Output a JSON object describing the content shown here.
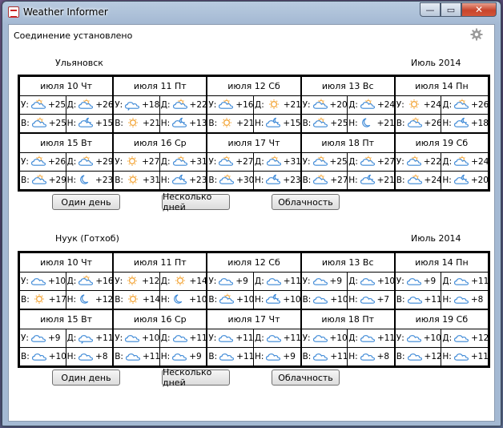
{
  "window": {
    "title": "Weather Informer",
    "minimize": "—",
    "maximize": "▭",
    "close": "✕"
  },
  "status": "Соединение установлено",
  "icon_legend": {
    "sun": "sun-icon",
    "cloud": "cloud-icon",
    "partly": "partly-cloudy-icon",
    "rain": "rain-cloud-icon",
    "moon": "moon-icon",
    "night_cloud": "night-cloud-icon"
  },
  "colors": {
    "sun": "#f3a63a",
    "cloud": "#3a87d6",
    "border": "#000000"
  },
  "buttons": {
    "one_day": "Один день",
    "several_days": "Несколько дней",
    "cloudiness": "Облачность"
  },
  "panels": [
    {
      "city": "Ульяновск",
      "month": "Июль 2014",
      "days": [
        {
          "date": "июля 10 Чт",
          "cells": [
            {
              "label": "У:",
              "icon": "partly",
              "temp": "+25"
            },
            {
              "label": "Д:",
              "icon": "partly",
              "temp": "+26"
            },
            {
              "label": "В:",
              "icon": "partly",
              "temp": "+25"
            },
            {
              "label": "Н:",
              "icon": "night_cloud",
              "temp": "+15"
            }
          ]
        },
        {
          "date": "июля 11 Пт",
          "cells": [
            {
              "label": "У:",
              "icon": "rain",
              "temp": "+18"
            },
            {
              "label": "Д:",
              "icon": "partly",
              "temp": "+22"
            },
            {
              "label": "В:",
              "icon": "sun",
              "temp": "+21"
            },
            {
              "label": "Н:",
              "icon": "night_cloud",
              "temp": "+13"
            }
          ]
        },
        {
          "date": "июля 12 Сб",
          "cells": [
            {
              "label": "У:",
              "icon": "partly",
              "temp": "+16"
            },
            {
              "label": "Д:",
              "icon": "sun",
              "temp": "+21"
            },
            {
              "label": "В:",
              "icon": "sun",
              "temp": "+21"
            },
            {
              "label": "Н:",
              "icon": "night_cloud",
              "temp": "+15"
            }
          ]
        },
        {
          "date": "июля 13 Вс",
          "cells": [
            {
              "label": "У:",
              "icon": "partly",
              "temp": "+20"
            },
            {
              "label": "Д:",
              "icon": "partly",
              "temp": "+24"
            },
            {
              "label": "В:",
              "icon": "partly",
              "temp": "+25"
            },
            {
              "label": "Н:",
              "icon": "moon",
              "temp": "+21"
            }
          ]
        },
        {
          "date": "июля 14 Пн",
          "cells": [
            {
              "label": "У:",
              "icon": "sun",
              "temp": "+24"
            },
            {
              "label": "Д:",
              "icon": "partly",
              "temp": "+26"
            },
            {
              "label": "В:",
              "icon": "partly",
              "temp": "+26"
            },
            {
              "label": "Н:",
              "icon": "night_cloud",
              "temp": "+18"
            }
          ]
        },
        {
          "date": "июля 15 Вт",
          "cells": [
            {
              "label": "У:",
              "icon": "partly",
              "temp": "+26"
            },
            {
              "label": "Д:",
              "icon": "partly",
              "temp": "+29"
            },
            {
              "label": "В:",
              "icon": "partly",
              "temp": "+29"
            },
            {
              "label": "Н:",
              "icon": "moon",
              "temp": "+23"
            }
          ]
        },
        {
          "date": "июля 16 Ср",
          "cells": [
            {
              "label": "У:",
              "icon": "sun",
              "temp": "+27"
            },
            {
              "label": "Д:",
              "icon": "partly",
              "temp": "+31"
            },
            {
              "label": "В:",
              "icon": "sun",
              "temp": "+31"
            },
            {
              "label": "Н:",
              "icon": "night_cloud",
              "temp": "+23"
            }
          ]
        },
        {
          "date": "июля 17 Чт",
          "cells": [
            {
              "label": "У:",
              "icon": "partly",
              "temp": "+27"
            },
            {
              "label": "Д:",
              "icon": "partly",
              "temp": "+31"
            },
            {
              "label": "В:",
              "icon": "partly",
              "temp": "+30"
            },
            {
              "label": "Н:",
              "icon": "night_cloud",
              "temp": "+23"
            }
          ]
        },
        {
          "date": "июля 18 Пт",
          "cells": [
            {
              "label": "У:",
              "icon": "partly",
              "temp": "+25"
            },
            {
              "label": "Д:",
              "icon": "partly",
              "temp": "+27"
            },
            {
              "label": "В:",
              "icon": "partly",
              "temp": "+27"
            },
            {
              "label": "Н:",
              "icon": "night_cloud",
              "temp": "+21"
            }
          ]
        },
        {
          "date": "июля 19 Сб",
          "cells": [
            {
              "label": "У:",
              "icon": "partly",
              "temp": "+22"
            },
            {
              "label": "Д:",
              "icon": "partly",
              "temp": "+24"
            },
            {
              "label": "В:",
              "icon": "partly",
              "temp": "+24"
            },
            {
              "label": "Н:",
              "icon": "night_cloud",
              "temp": "+20"
            }
          ]
        }
      ]
    },
    {
      "city": "Нуук (Готхоб)",
      "month": "Июль 2014",
      "days": [
        {
          "date": "июля 10 Чт",
          "cells": [
            {
              "label": "У:",
              "icon": "cloud",
              "temp": "+10"
            },
            {
              "label": "Д:",
              "icon": "partly",
              "temp": "+16"
            },
            {
              "label": "В:",
              "icon": "sun",
              "temp": "+17"
            },
            {
              "label": "Н:",
              "icon": "moon",
              "temp": "+12"
            }
          ]
        },
        {
          "date": "июля 11 Пт",
          "cells": [
            {
              "label": "У:",
              "icon": "sun",
              "temp": "+12"
            },
            {
              "label": "Д:",
              "icon": "sun",
              "temp": "+14"
            },
            {
              "label": "В:",
              "icon": "sun",
              "temp": "+14"
            },
            {
              "label": "Н:",
              "icon": "moon",
              "temp": "+10"
            }
          ]
        },
        {
          "date": "июля 12 Сб",
          "cells": [
            {
              "label": "У:",
              "icon": "cloud",
              "temp": "+9"
            },
            {
              "label": "Д:",
              "icon": "cloud",
              "temp": "+11"
            },
            {
              "label": "В:",
              "icon": "partly",
              "temp": "+10"
            },
            {
              "label": "Н:",
              "icon": "night_cloud",
              "temp": "+10"
            }
          ]
        },
        {
          "date": "июля 13 Вс",
          "cells": [
            {
              "label": "У:",
              "icon": "cloud",
              "temp": "+9"
            },
            {
              "label": "Д:",
              "icon": "cloud",
              "temp": "+10"
            },
            {
              "label": "В:",
              "icon": "cloud",
              "temp": "+10"
            },
            {
              "label": "Н:",
              "icon": "cloud",
              "temp": "+7"
            }
          ]
        },
        {
          "date": "июля 14 Пн",
          "cells": [
            {
              "label": "У:",
              "icon": "cloud",
              "temp": "+9"
            },
            {
              "label": "Д:",
              "icon": "cloud",
              "temp": "+11"
            },
            {
              "label": "В:",
              "icon": "cloud",
              "temp": "+11"
            },
            {
              "label": "Н:",
              "icon": "cloud",
              "temp": "+8"
            }
          ]
        },
        {
          "date": "июля 15 Вт",
          "cells": [
            {
              "label": "У:",
              "icon": "cloud",
              "temp": "+9"
            },
            {
              "label": "Д:",
              "icon": "rain",
              "temp": "+11"
            },
            {
              "label": "В:",
              "icon": "cloud",
              "temp": "+10"
            },
            {
              "label": "Н:",
              "icon": "cloud",
              "temp": "+8"
            }
          ]
        },
        {
          "date": "июля 16 Ср",
          "cells": [
            {
              "label": "У:",
              "icon": "cloud",
              "temp": "+10"
            },
            {
              "label": "Д:",
              "icon": "cloud",
              "temp": "+11"
            },
            {
              "label": "В:",
              "icon": "cloud",
              "temp": "+11"
            },
            {
              "label": "Н:",
              "icon": "cloud",
              "temp": "+9"
            }
          ]
        },
        {
          "date": "июля 17 Чт",
          "cells": [
            {
              "label": "У:",
              "icon": "cloud",
              "temp": "+11"
            },
            {
              "label": "Д:",
              "icon": "cloud",
              "temp": "+11"
            },
            {
              "label": "В:",
              "icon": "cloud",
              "temp": "+11"
            },
            {
              "label": "Н:",
              "icon": "cloud",
              "temp": "+9"
            }
          ]
        },
        {
          "date": "июля 18 Пт",
          "cells": [
            {
              "label": "У:",
              "icon": "cloud",
              "temp": "+10"
            },
            {
              "label": "Д:",
              "icon": "cloud",
              "temp": "+11"
            },
            {
              "label": "В:",
              "icon": "cloud",
              "temp": "+11"
            },
            {
              "label": "Н:",
              "icon": "cloud",
              "temp": "+8"
            }
          ]
        },
        {
          "date": "июля 19 Сб",
          "cells": [
            {
              "label": "У:",
              "icon": "cloud",
              "temp": "+10"
            },
            {
              "label": "Д:",
              "icon": "cloud",
              "temp": "+12"
            },
            {
              "label": "В:",
              "icon": "cloud",
              "temp": "+12"
            },
            {
              "label": "Н:",
              "icon": "cloud",
              "temp": "+11"
            }
          ]
        }
      ]
    }
  ]
}
